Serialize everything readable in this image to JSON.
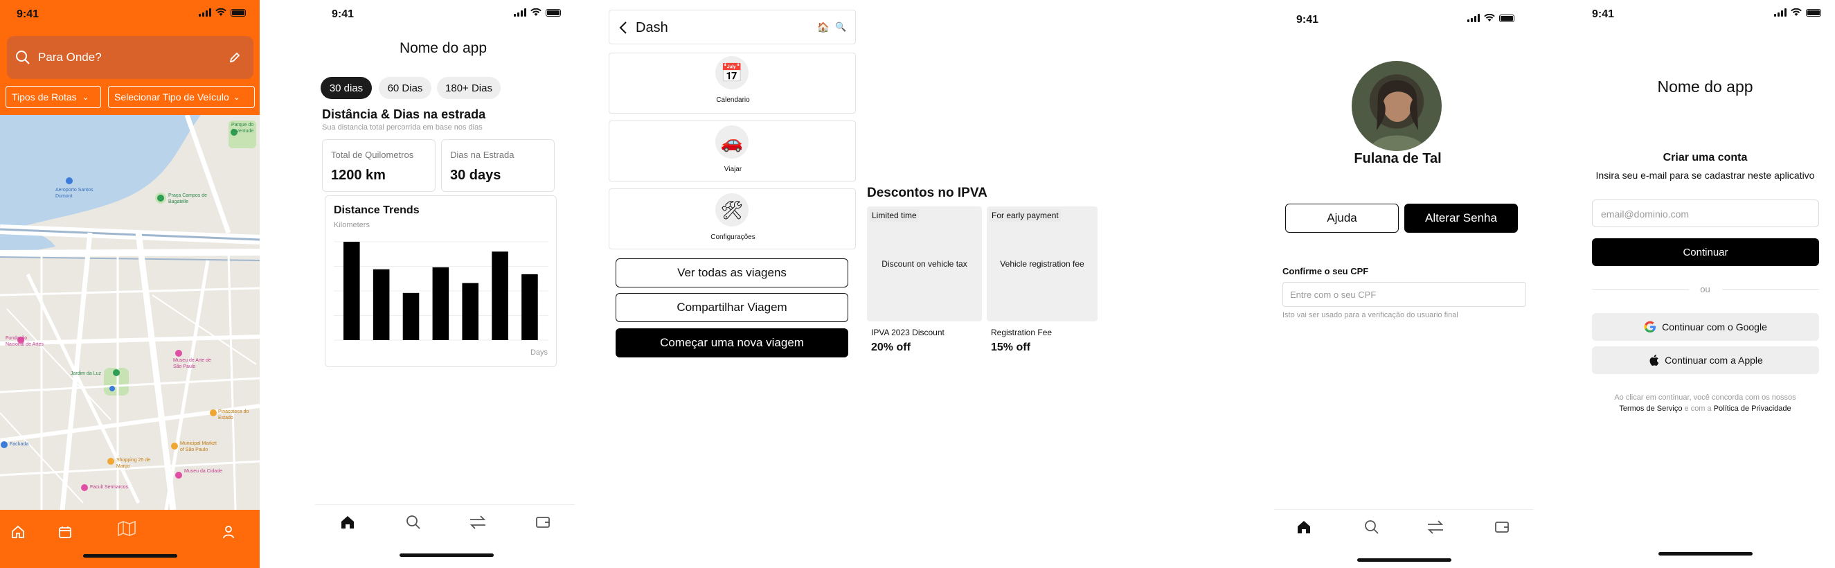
{
  "colors": {
    "brand_orange": "#ff6b0a",
    "dark": "#111111",
    "light_gray": "#efefef"
  },
  "status_time": "9:41",
  "screen1": {
    "search_placeholder": "Para Onde?",
    "filter_route": "Tipos de Rotas",
    "filter_vehicle": "Selecionar Tipo de Veículo",
    "map_labels": {
      "airport": "Aeroporto Santos Dumont",
      "praca": "Praça Campos de Bagatelle",
      "parque": "Parque do Juventude",
      "fundacao": "Fundação Nacional de Artes",
      "jardim": "Jardim da Luz",
      "museu": "Museu de Arte de São Paulo",
      "pinacoteca": "Pinacoteca do Estado",
      "municipal": "Municipal Market of São Paulo",
      "museu_cidade": "Museu da Cidade",
      "facul": "Facult Sermarcos",
      "shopping": "Shopping 25 de Março",
      "fachada": "Fachada"
    }
  },
  "screen2": {
    "app_name": "Nome do app",
    "tabs": [
      "30 dias",
      "60 Dias",
      "180+ Dias"
    ],
    "section_title": "Distância & Dias na estrada",
    "section_subtitle": "Sua distancia total percorrida em base nos dias",
    "stat1_label": "Total de Quilometros",
    "stat1_value": "1200 km",
    "stat2_label": "Dias na Estrada",
    "stat2_value": "30 days"
  },
  "chart_data": {
    "type": "bar",
    "title": "Distance Trends",
    "ylabel": "Kilometers",
    "xlabel": "Days",
    "values": [
      100,
      72,
      48,
      74,
      58,
      90,
      67
    ],
    "ylim": [
      0,
      100
    ]
  },
  "screen3": {
    "header_title": "Dash",
    "tiles": [
      {
        "label": "Calendario",
        "icon": "calendar-icon"
      },
      {
        "label": "Viajar",
        "icon": "car-icon"
      },
      {
        "label": "Configurações",
        "icon": "tools-icon"
      }
    ],
    "btn_all_trips": "Ver todas as viagens",
    "btn_share": "Compartilhar Viagem",
    "btn_start": "Começar uma nova viagem"
  },
  "screen4": {
    "title": "Descontos no IPVA",
    "cards": [
      {
        "badge": "Limited time",
        "image_text": "Discount on vehicle tax",
        "name": "IPVA 2023 Discount",
        "value": "20% off"
      },
      {
        "badge": "For early payment",
        "image_text": "Vehicle registration fee",
        "name": "Registration Fee",
        "value": "15% off"
      }
    ]
  },
  "screen5": {
    "name": "Fulana de Tal",
    "btn_help": "Ajuda",
    "btn_change_password": "Alterar Senha",
    "cpf_label": "Confirme o seu CPF",
    "cpf_placeholder": "Entre com o seu CPF",
    "cpf_hint": "Isto vai ser usado para a verificação do usuario final"
  },
  "screen6": {
    "app_name": "Nome do app",
    "create_title": "Criar uma conta",
    "create_subtitle": "Insira seu e-mail para se cadastrar neste aplicativo",
    "email_placeholder": "email@dominio.com",
    "btn_continue": "Continuar",
    "divider": "ou",
    "btn_google": "Continuar com o Google",
    "btn_apple": "Continuar com a Apple",
    "legal_1": "Ao clicar em continuar, você concorda com os nossos",
    "legal_terms": "Termos de Serviço",
    "legal_and": "e com a",
    "legal_privacy": "Política de Privacidade"
  }
}
